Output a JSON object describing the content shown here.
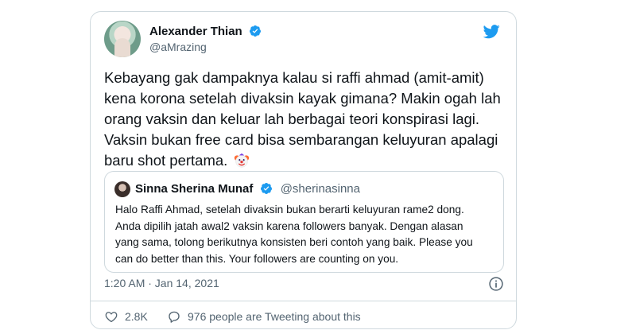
{
  "author": {
    "name": "Alexander Thian",
    "handle": "@aMrazing"
  },
  "tweet": {
    "line1": "Kebayang gak dampaknya kalau si raffi ahmad (amit-amit)",
    "line2": "kena korona setelah divaksin kayak gimana? Makin ogah lah",
    "line3": "orang vaksin dan keluar lah berbagai teori konspirasi lagi.",
    "line4": "Vaksin bukan free card bisa sembarangan keluyuran apalagi",
    "line5": "baru shot pertama.",
    "emoji": "clown-face-emoji"
  },
  "quote": {
    "name": "Sinna Sherina Munaf",
    "handle": "@sherinasinna",
    "line1": "Halo Raffi Ahmad, setelah divaksin bukan berarti keluyuran rame2 dong.",
    "line2": "Anda dipilih jatah awal2 vaksin karena followers banyak. Dengan alasan",
    "line3": "yang sama, tolong berikutnya konsisten beri contoh yang baik. Please you",
    "line4": "can do better than this. Your followers are counting on you."
  },
  "timestamp": "1:20 AM · Jan 14, 2021",
  "actions": {
    "likes": "2.8K",
    "conversation": "976 people are Tweeting about this"
  },
  "colors": {
    "accent": "#1d9bf0",
    "border": "#cfd9de",
    "secondary_text": "#536471",
    "text": "#0f1419"
  }
}
